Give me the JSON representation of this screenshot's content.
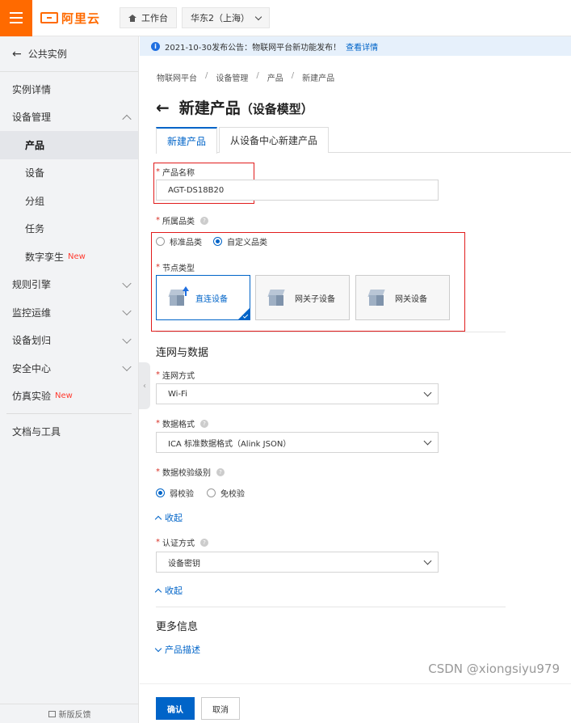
{
  "topbar": {
    "logo_text": "阿里云",
    "workbench_label": "工作台",
    "region_label": "华东2（上海）"
  },
  "sidebar": {
    "back_label": "公共实例",
    "items": [
      {
        "label": "实例详情"
      },
      {
        "label": "设备管理"
      },
      {
        "label": "产品"
      },
      {
        "label": "设备"
      },
      {
        "label": "分组"
      },
      {
        "label": "任务"
      },
      {
        "label": "数字孪生",
        "badge": "New"
      },
      {
        "label": "规则引擎"
      },
      {
        "label": "监控运维"
      },
      {
        "label": "设备划归"
      },
      {
        "label": "安全中心"
      },
      {
        "label": "仿真实验",
        "badge": "New"
      },
      {
        "label": "文档与工具"
      }
    ],
    "feedback_label": "新版反馈"
  },
  "notice": {
    "text": "2021-10-30发布公告：物联网平台新功能发布！",
    "link": "查看详情"
  },
  "breadcrumb": [
    "物联网平台",
    "设备管理",
    "产品",
    "新建产品"
  ],
  "breadcrumb_sep": "/",
  "page": {
    "title": "新建产品",
    "subtitle": "（设备模型）"
  },
  "tabs": [
    {
      "label": "新建产品",
      "active": true
    },
    {
      "label": "从设备中心新建产品",
      "active": false
    }
  ],
  "form": {
    "product_name_label": "产品名称",
    "product_name_value": "AGT-DS18B20",
    "category_label": "所属品类",
    "category_options": [
      "标准品类",
      "自定义品类"
    ],
    "category_selected": "自定义品类",
    "node_type_label": "节点类型",
    "node_types": [
      "直连设备",
      "网关子设备",
      "网关设备"
    ],
    "node_type_selected": "直连设备",
    "section_network": "连网与数据",
    "network_label": "连网方式",
    "network_value": "Wi-Fi",
    "data_format_label": "数据格式",
    "data_format_value": "ICA 标准数据格式（Alink JSON）",
    "check_level_label": "数据校验级别",
    "check_options": [
      "弱校验",
      "免校验"
    ],
    "check_selected": "弱校验",
    "collapse_label": "收起",
    "auth_label": "认证方式",
    "auth_value": "设备密钥",
    "collapse_label_2": "收起",
    "section_more": "更多信息",
    "product_desc_label": "产品描述",
    "required_mark": "*"
  },
  "buttons": {
    "confirm": "确认",
    "cancel": "取消"
  },
  "watermark": "CSDN @xiongsiyu979",
  "colors": {
    "brand": "#ff6a00",
    "primary": "#0064c8",
    "highlight_box": "#e11c1c"
  }
}
